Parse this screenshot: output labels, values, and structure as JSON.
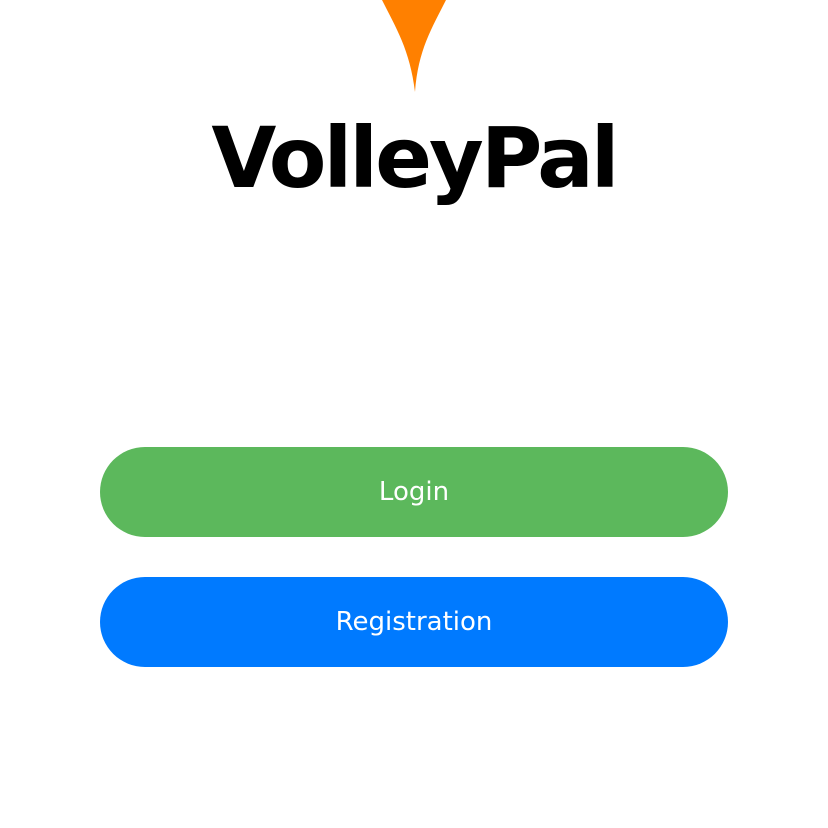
{
  "app": {
    "title": "VolleyPal",
    "logo_icon": "volleyball-droplet-icon",
    "logo_color": "#ff8000"
  },
  "actions": {
    "login_label": "Login",
    "login_color": "#5cb85c",
    "registration_label": "Registration",
    "registration_color": "#007aff"
  }
}
